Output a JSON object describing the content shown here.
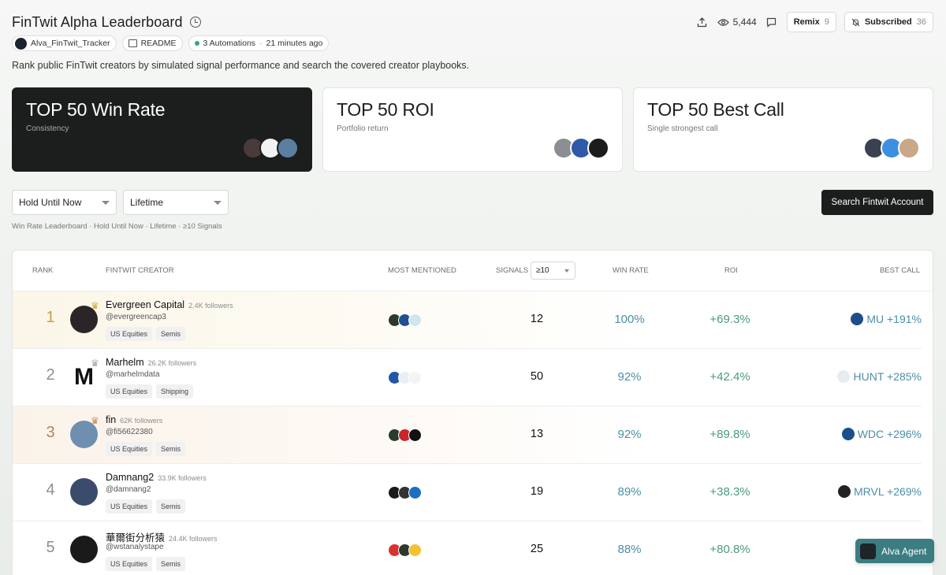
{
  "header": {
    "title": "FinTwit Alpha Leaderboard",
    "views": "5,444",
    "remix_label": "Remix",
    "remix_count": "9",
    "subscribed_label": "Subscribed",
    "subscribed_count": "36"
  },
  "meta": {
    "owner": "Alva_FinTwit_Tracker",
    "readme": "README",
    "automations": "3 Automations",
    "updated": "21 minutes ago"
  },
  "subtitle": "Rank public FinTwit creators by simulated signal performance and search the covered creator playbooks.",
  "cards": [
    {
      "title": "TOP 50 Win Rate",
      "sub": "Consistency"
    },
    {
      "title": "TOP 50 ROI",
      "sub": "Portfolio return"
    },
    {
      "title": "TOP 50 Best Call",
      "sub": "Single strongest call"
    }
  ],
  "filters": {
    "hold": "Hold Until Now",
    "period": "Lifetime",
    "search_button": "Search Fintwit Account",
    "crumb": "Win Rate Leaderboard · Hold Until Now · Lifetime · ≥10 Signals"
  },
  "table": {
    "headers": {
      "rank": "RANK",
      "creator": "FINTWIT CREATOR",
      "mentioned": "MOST MENTIONED",
      "signals": "SIGNALS",
      "signals_filter": "≥10",
      "win_rate": "WIN RATE",
      "roi": "ROI",
      "best_call": "BEST CALL"
    },
    "rows": [
      {
        "rank": "1",
        "name": "Evergreen Capital",
        "followers": "2.4K followers",
        "handle": "@evergreencap3",
        "tags": [
          "US Equities",
          "Semis"
        ],
        "signals": "12",
        "win_rate": "100%",
        "roi": "+69.3%",
        "best_call": "MU +191%"
      },
      {
        "rank": "2",
        "name": "Marhelm",
        "followers": "26.2K followers",
        "handle": "@marhelmdata",
        "tags": [
          "US Equities",
          "Shipping"
        ],
        "signals": "50",
        "win_rate": "92%",
        "roi": "+42.4%",
        "best_call": "HUNT +285%"
      },
      {
        "rank": "3",
        "name": "fin",
        "followers": "62K followers",
        "handle": "@fi56622380",
        "tags": [
          "US Equities",
          "Semis"
        ],
        "signals": "13",
        "win_rate": "92%",
        "roi": "+89.8%",
        "best_call": "WDC +296%"
      },
      {
        "rank": "4",
        "name": "Damnang2",
        "followers": "33.9K followers",
        "handle": "@damnang2",
        "tags": [
          "US Equities",
          "Semis"
        ],
        "signals": "19",
        "win_rate": "89%",
        "roi": "+38.3%",
        "best_call": "MRVL +269%"
      },
      {
        "rank": "5",
        "name": "華爾街分析猿",
        "followers": "24.4K followers",
        "handle": "@wstanalystape",
        "tags": [
          "US Equities",
          "Semis"
        ],
        "signals": "25",
        "win_rate": "88%",
        "roi": "+80.8%",
        "best_call": ""
      }
    ]
  },
  "agent_button": "Alva Agent"
}
